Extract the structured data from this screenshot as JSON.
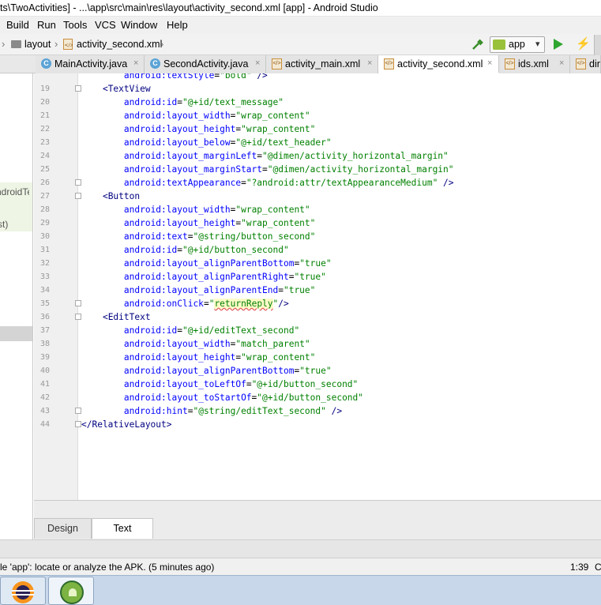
{
  "window": {
    "title": "ts\\TwoActivities] - ...\\app\\src\\main\\res\\layout\\activity_second.xml [app] - Android Studio"
  },
  "menu": [
    "Build",
    "Run",
    "Tools",
    "VCS",
    "Window",
    "Help"
  ],
  "breadcrumb": [
    "layout",
    "activity_second.xml"
  ],
  "toolbar": {
    "run_config": "app",
    "icons": [
      "hammer-icon",
      "android-icon",
      "run-icon",
      "lightning-icon"
    ]
  },
  "tabs": [
    {
      "label": "MainActivity.java",
      "icon": "java-class-icon",
      "active": false
    },
    {
      "label": "SecondActivity.java",
      "icon": "java-class-icon",
      "active": false
    },
    {
      "label": "activity_main.xml",
      "icon": "xml-file-icon",
      "active": false
    },
    {
      "label": "activity_second.xml",
      "icon": "xml-file-icon",
      "active": true
    },
    {
      "label": "ids.xml",
      "icon": "xml-file-icon",
      "active": false
    },
    {
      "label": "dir",
      "icon": "xml-file-icon",
      "active": false
    }
  ],
  "left_panel": {
    "fragments": [
      "ndroidTe",
      "st)"
    ]
  },
  "editor": {
    "partial_top_line": "android:textStyle=\"bold\" />",
    "lines": [
      {
        "n": "19",
        "text": "<TextView"
      },
      {
        "n": "20",
        "text": "android:id=\"@+id/text_message\""
      },
      {
        "n": "21",
        "text": "android:layout_width=\"wrap_content\""
      },
      {
        "n": "22",
        "text": "android:layout_height=\"wrap_content\""
      },
      {
        "n": "23",
        "text": "android:layout_below=\"@+id/text_header\""
      },
      {
        "n": "24",
        "text": "android:layout_marginLeft=\"@dimen/activity_horizontal_margin\""
      },
      {
        "n": "25",
        "text": "android:layout_marginStart=\"@dimen/activity_horizontal_margin\""
      },
      {
        "n": "26",
        "text": "android:textAppearance=\"?android:attr/textAppearanceMedium\" />"
      },
      {
        "n": "27",
        "text": "<Button"
      },
      {
        "n": "28",
        "text": "android:layout_width=\"wrap_content\""
      },
      {
        "n": "29",
        "text": "android:layout_height=\"wrap_content\""
      },
      {
        "n": "30",
        "text": "android:text=\"@string/button_second\""
      },
      {
        "n": "31",
        "text": "android:id=\"@+id/button_second\""
      },
      {
        "n": "32",
        "text": "android:layout_alignParentBottom=\"true\""
      },
      {
        "n": "33",
        "text": "android:layout_alignParentRight=\"true\""
      },
      {
        "n": "34",
        "text": "android:layout_alignParentEnd=\"true\""
      },
      {
        "n": "35",
        "text": "android:onClick=\"returnReply\"/>"
      },
      {
        "n": "36",
        "text": "<EditText"
      },
      {
        "n": "37",
        "text": "android:id=\"@+id/editText_second\""
      },
      {
        "n": "38",
        "text": "android:layout_width=\"match_parent\""
      },
      {
        "n": "39",
        "text": "android:layout_height=\"wrap_content\""
      },
      {
        "n": "40",
        "text": "android:layout_alignParentBottom=\"true\""
      },
      {
        "n": "41",
        "text": "android:layout_toLeftOf=\"@+id/button_second\""
      },
      {
        "n": "42",
        "text": "android:layout_toStartOf=\"@+id/button_second\""
      },
      {
        "n": "43",
        "text": "android:hint=\"@string/editText_second\" />"
      },
      {
        "n": "44",
        "text": "</RelativeLayout>"
      }
    ]
  },
  "bottom_tabs": {
    "design": "Design",
    "text": "Text"
  },
  "status": {
    "message": "le 'app': locate or analyze the APK. (5 minutes ago)",
    "position": "1:39",
    "extra": "C"
  },
  "taskbar": {
    "apps": [
      "eclipse-icon",
      "android-studio-icon"
    ]
  },
  "colors": {
    "tag": "#000080",
    "attribute": "#0000ff",
    "value": "#008000",
    "run_green": "#2fa62f"
  }
}
